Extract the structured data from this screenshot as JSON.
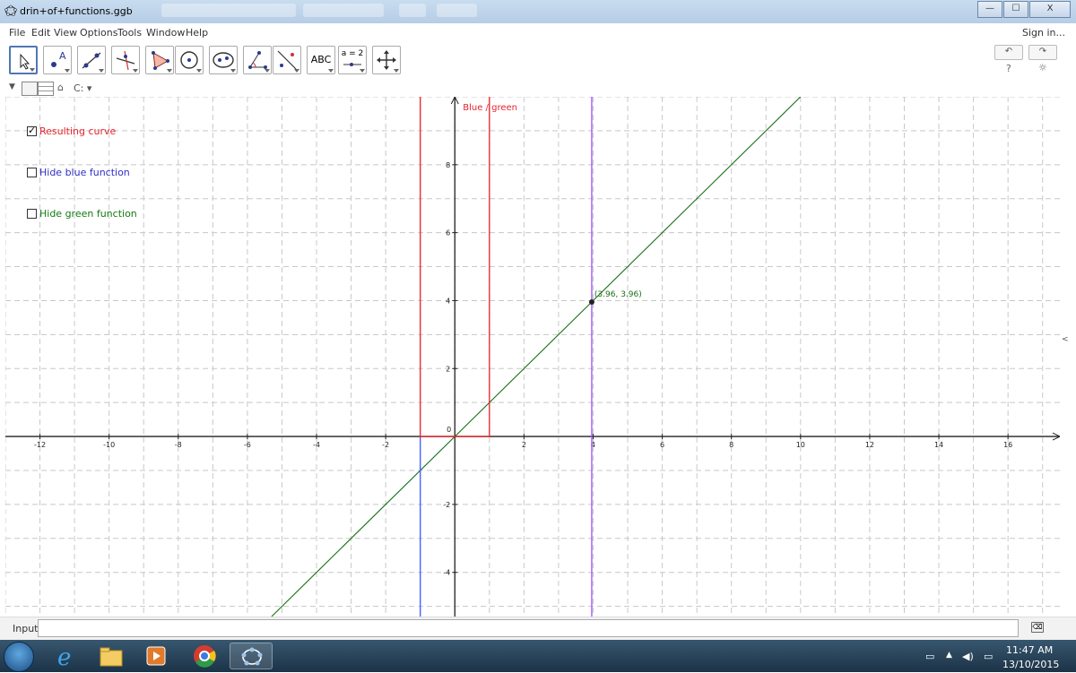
{
  "window": {
    "title": "drin+of+functions.ggb",
    "controls": {
      "minimize": "—",
      "maximize": "☐",
      "close": "X"
    }
  },
  "menu": {
    "items": [
      "File",
      "Edit",
      "View",
      "Options",
      "Tools",
      "Window",
      "Help"
    ],
    "sign_in": "Sign in..."
  },
  "toolbar": {
    "tools": [
      {
        "name": "move",
        "icon": "pointer-icon"
      },
      {
        "name": "point",
        "icon": "point-icon"
      },
      {
        "name": "line",
        "icon": "line-icon"
      },
      {
        "name": "perpendicular",
        "icon": "perpendicular-icon"
      },
      {
        "name": "polygon",
        "icon": "polygon-icon"
      },
      {
        "name": "circle",
        "icon": "circle-icon"
      },
      {
        "name": "ellipse",
        "icon": "ellipse-icon"
      },
      {
        "name": "angle",
        "icon": "angle-icon"
      },
      {
        "name": "reflect",
        "icon": "reflect-icon"
      },
      {
        "name": "text",
        "icon": "text-icon",
        "label": "ABC"
      },
      {
        "name": "slider",
        "icon": "slider-icon",
        "label": "a = 2"
      },
      {
        "name": "move-graphics",
        "icon": "move-graphics-icon"
      }
    ],
    "undo": "↶",
    "redo": "↷",
    "help": "?",
    "settings": "☼"
  },
  "viewbar": {
    "style": "C:"
  },
  "graphics": {
    "checkboxes": [
      {
        "label": "Resulting curve",
        "checked": true,
        "color": "#e8232a"
      },
      {
        "label": "Hide blue function",
        "checked": false,
        "color": "#2e2ec8"
      },
      {
        "label": "Hide green function",
        "checked": false,
        "color": "#127a12"
      }
    ],
    "curve_label": "Blue / green",
    "point_label": "(3.96, 3.96)",
    "point": {
      "x": 3.96,
      "y": 3.96
    },
    "x_range": [
      -13,
      17.5
    ],
    "y_range": [
      -5.3,
      10
    ],
    "x_ticks": [
      "-12",
      "-10",
      "-8",
      "-6",
      "-4",
      "-2",
      "0",
      "2",
      "4",
      "6",
      "8",
      "10",
      "12",
      "14",
      "16"
    ],
    "y_ticks": [
      "8",
      "6",
      "4",
      "2",
      "0",
      "-2",
      "-4"
    ],
    "colors": {
      "blue": "#3b5bff",
      "red": "#e8232a",
      "green": "#177017",
      "purple": "#9b4fff",
      "grid": "#c8c8c8"
    }
  },
  "input_bar": {
    "label": "Input:",
    "value": ""
  },
  "taskbar": {
    "time": "11:47 AM",
    "date": "13/10/2015"
  }
}
